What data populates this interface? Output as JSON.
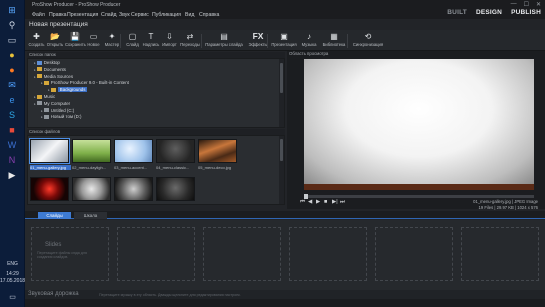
{
  "window": {
    "title": "ProShow Producer - ProShow Producer",
    "minimize": "—",
    "maximize": "☐",
    "close": "✕"
  },
  "menu": [
    "Файл",
    "Правка",
    "Презентация",
    "Слайд",
    "Звук",
    "Сервис",
    "Публикация",
    "Вид",
    "Справка"
  ],
  "modes": {
    "build": "BUILT",
    "design": "DESIGN",
    "publish": "PUBLISH"
  },
  "presentation_name": "Новая презентация",
  "toolbar": [
    {
      "label": "Создать",
      "icon": "new-icon",
      "glyph": "✚"
    },
    {
      "label": "Открыть",
      "icon": "open-icon",
      "glyph": "📂"
    },
    {
      "label": "Сохранить",
      "icon": "save-icon",
      "glyph": "💾"
    },
    {
      "label": "Новое",
      "icon": "new-show-icon",
      "glyph": "▭"
    },
    {
      "label": "Мастер",
      "icon": "wizard-icon",
      "glyph": "✦"
    },
    {
      "label": "Слайд",
      "icon": "slide-icon",
      "glyph": "▢"
    },
    {
      "label": "Надпись",
      "icon": "caption-icon",
      "glyph": "T"
    },
    {
      "label": "Импорт",
      "icon": "import-icon",
      "glyph": "⇩"
    },
    {
      "label": "Переходы",
      "icon": "transitions-icon",
      "glyph": "⇄"
    },
    {
      "label": "Параметры слайда",
      "icon": "slide-options-icon",
      "glyph": "▤"
    },
    {
      "label": "Эффекты",
      "icon": "effects-icon",
      "glyph": "FX"
    },
    {
      "label": "Презентация",
      "icon": "show-icon",
      "glyph": "▣"
    },
    {
      "label": "Музыка",
      "icon": "music-icon",
      "glyph": "♪"
    },
    {
      "label": "Библиотека",
      "icon": "library-icon",
      "glyph": "▦"
    },
    {
      "label": "Синхронизация",
      "icon": "sync-icon",
      "glyph": "⟲"
    }
  ],
  "folders_panel": {
    "title": "Список папок",
    "items": [
      {
        "label": "Desktop",
        "level": 0,
        "color": "blue"
      },
      {
        "label": "Documents",
        "level": 0,
        "color": "yellow"
      },
      {
        "label": "Media Sources",
        "level": 0,
        "color": "yellow"
      },
      {
        "label": "ProShow Producer 9.0 - Built-in Content",
        "level": 1,
        "color": "yellow"
      },
      {
        "label": "Backgrounds",
        "level": 2,
        "color": "yellow",
        "selected": true
      },
      {
        "label": "Music",
        "level": 0,
        "color": "yellow"
      },
      {
        "label": "My Computer",
        "level": 0,
        "color": "gray"
      },
      {
        "label": "Untitled (C:)",
        "level": 1,
        "color": "gray"
      },
      {
        "label": "Новый том (D:)",
        "level": 1,
        "color": "gray"
      }
    ]
  },
  "files_panel": {
    "title": "Список файлов",
    "files": [
      {
        "name": "01_menu-gallery.jpg",
        "selected": true,
        "bg": "linear-gradient(135deg,#9aa4b0,#f4f5f7 50%,#8c96a2)"
      },
      {
        "name": "02_menu-dayligh...",
        "bg": "linear-gradient(180deg,#c6e09a,#7fb04a 60%,#436b22)"
      },
      {
        "name": "03_menu-accent...",
        "bg": "radial-gradient(circle at 40% 40%,#e9f3ff,#9ec2ea 60%,#5f86b8)"
      },
      {
        "name": "04_menu-classic...",
        "bg": "radial-gradient(circle at 50% 40%,#5e5e5e,#252525 70%)"
      },
      {
        "name": "05_menu-deco.jpg",
        "bg": "linear-gradient(160deg,#2a1a10,#c8763b 40%,#4a2a16 70%,#a35a28)"
      },
      {
        "name": "",
        "bg": "radial-gradient(circle at 50% 50%,#ff3a2a,#7a0a08 40%,#160404 75%)"
      },
      {
        "name": "",
        "bg": "radial-gradient(circle at 50% 50%,#e8e8e8,#9a9a9a 45%,#2e2e2e 85%)"
      },
      {
        "name": "",
        "bg": "radial-gradient(circle at 50% 50%,#cfcfcf,#5a5a5a 55%,#1a1a1a 90%)"
      },
      {
        "name": "",
        "bg": "radial-gradient(circle at 50% 45%,#6a6a6a,#2a2a2a 60%,#0e0e0e)"
      }
    ]
  },
  "preview": {
    "title": "Область просмотра",
    "controls": [
      "⏮",
      "◀",
      "▶",
      "■",
      "▶|",
      "⏭"
    ],
    "file_name": "01_menu-gallery.jpg",
    "file_type": "JPEG Image",
    "details": "19 Files  |  29.97 KB  |  1024 x 576",
    "progress": 0
  },
  "tabs": [
    {
      "label": "Слайды",
      "active": true
    },
    {
      "label": "Шкала",
      "active": false
    }
  ],
  "slides_strip": {
    "placeholder_title": "Slides",
    "placeholder_sub": "Перетащите файлы сюда для создания слайдов.",
    "slots": 6
  },
  "audio": {
    "title": "Звуковая дорожка",
    "hint": "Перетащите музыку в эту область. Дважды щелкните для редактирования настроек."
  },
  "taskbar": {
    "icons": [
      {
        "name": "windows-start-icon",
        "glyph": "⊞",
        "color": "#5aa9ff"
      },
      {
        "name": "search-icon",
        "glyph": "⚲",
        "color": "#cfd8e6"
      },
      {
        "name": "task-view-icon",
        "glyph": "▭",
        "color": "#cfd8e6"
      },
      {
        "name": "chrome-icon",
        "glyph": "●",
        "color": "#e8c23a"
      },
      {
        "name": "firefox-icon",
        "glyph": "●",
        "color": "#ff7a22"
      },
      {
        "name": "mail-icon",
        "glyph": "✉",
        "color": "#4fa0ff"
      },
      {
        "name": "edge-icon",
        "glyph": "e",
        "color": "#3a8fe8"
      },
      {
        "name": "skype-icon",
        "glyph": "S",
        "color": "#2fa9e8"
      },
      {
        "name": "app-icon-red",
        "glyph": "■",
        "color": "#e84a3a"
      },
      {
        "name": "word-icon",
        "glyph": "W",
        "color": "#3b6fd0"
      },
      {
        "name": "onenote-icon",
        "glyph": "N",
        "color": "#8a3fb0"
      },
      {
        "name": "proshow-icon",
        "glyph": "▶",
        "color": "#e8e8e8"
      }
    ],
    "lang": "ENG",
    "time": "14:29",
    "date": "17.05.2018"
  }
}
